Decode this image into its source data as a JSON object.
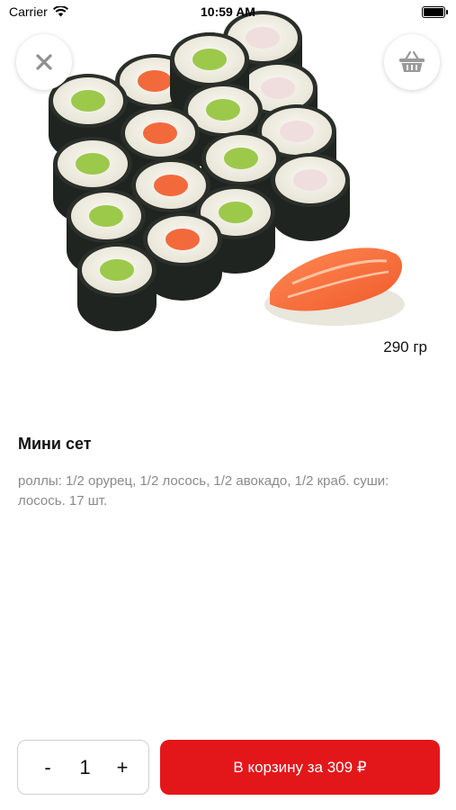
{
  "status_bar": {
    "carrier": "Carrier",
    "time": "10:59 AM",
    "wifi_icon": "wifi-icon",
    "battery_icon": "battery-icon"
  },
  "product": {
    "image": "sushi-set-photo",
    "weight": "290 гр",
    "title": "Мини сет",
    "description": "роллы: 1/2 орурец, 1/2 лосось, 1/2 авокадо, 1/2 краб. суши: лосось. 17 шт."
  },
  "controls": {
    "close_icon": "close-icon",
    "basket_icon": "basket-icon"
  },
  "quantity": {
    "minus": "-",
    "value": "1",
    "plus": "+"
  },
  "cart_button": {
    "label": "В корзину за 309 ₽"
  },
  "colors": {
    "accent": "#e3171a",
    "text": "#111111",
    "muted_text": "#8a8a8a"
  }
}
